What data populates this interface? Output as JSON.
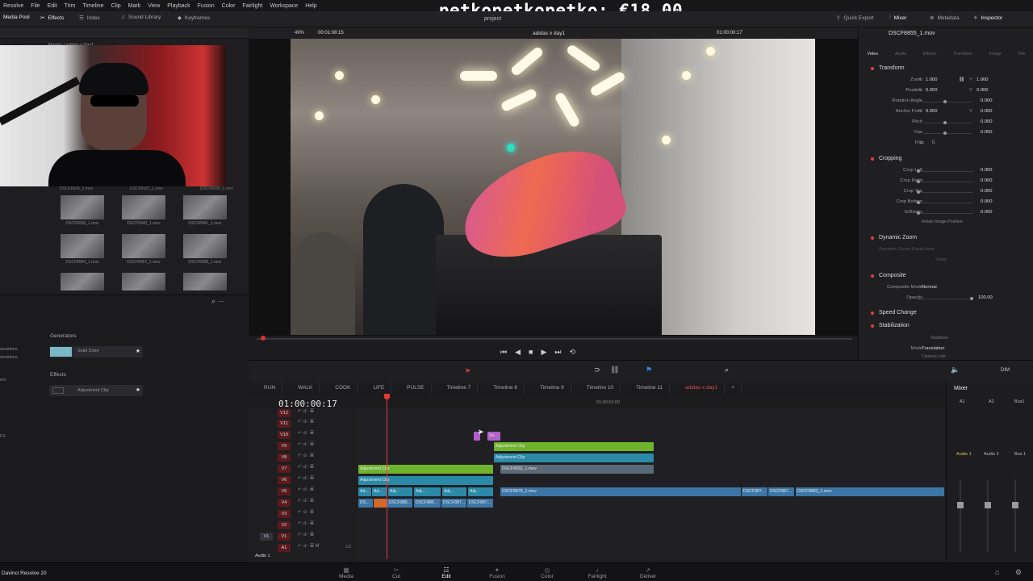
{
  "menubar": {
    "items": [
      "Resolve",
      "File",
      "Edit",
      "Trim",
      "Timeline",
      "Clip",
      "Mark",
      "View",
      "Playback",
      "Fusion",
      "Color",
      "Fairlight",
      "Workspace",
      "Help"
    ]
  },
  "overlay": {
    "donation_text": "petkopetkopetko: €18.00"
  },
  "toolbar": {
    "media_pool": "Media Pool",
    "effects": "Effects",
    "index": "Index",
    "sound_library": "Sound Library",
    "keyframes": "Keyframes",
    "project": "project",
    "quick_export": "Quick Export",
    "mixer": "Mixer",
    "metadata": "Metadata",
    "inspector": "Inspector"
  },
  "media_pool": {
    "breadcrumb": "Master / adidas x Day1",
    "thumbs": [
      "DSCF8939_1.mov",
      "DSCF8940_1.mov",
      "DSCF8941_1.mov",
      "DSCF8954_1.mov",
      "DSCF8967_1.mov",
      "DSCF8968_1.mov"
    ],
    "top_row": [
      "DSCF8936_1.mov",
      "DSCF8937_1.mov",
      "DSCF8938_1.mov"
    ]
  },
  "effects_panel": {
    "side_labels": [
      "ansitions",
      "ansitions",
      "ors",
      "FX"
    ],
    "generators_title": "Generators",
    "generator_item": "Solid Color",
    "effects_title": "Effects",
    "effect_item": "Adjustment Clip",
    "star": "★"
  },
  "viewer": {
    "zoom": "49%",
    "source_tc": "00:01:08:15",
    "timeline_name": "adidas x day1",
    "record_tc": "01:00:00:17",
    "transport": [
      "⏮",
      "◀",
      "■",
      "▶",
      "⏭",
      "⟲"
    ]
  },
  "inspector": {
    "clip_name": "DSCF8855_1.mov",
    "tabs": [
      "Video",
      "Audio",
      "Effects",
      "Transition",
      "Image",
      "File"
    ],
    "transform": "Transform",
    "zoom_label": "Zoom",
    "zoom_x": "1.000",
    "zoom_y": "1.000",
    "position_label": "Position",
    "position_x": "0.000",
    "position_y": "0.000",
    "rotation_label": "Rotation Angle",
    "rotation_value": "0.000",
    "anchor_label": "Anchor Point",
    "anchor_x": "0.000",
    "anchor_y": "0.000",
    "pitch_label": "Pitch",
    "pitch_value": "0.000",
    "yaw_label": "Yaw",
    "yaw_value": "0.000",
    "flip_label": "Flip",
    "cropping": "Cropping",
    "crop_left_label": "Crop Left",
    "crop_left": "0.000",
    "crop_right_label": "Crop Right",
    "crop_right": "0.000",
    "crop_top_label": "Crop Top",
    "crop_top": "0.000",
    "crop_bottom_label": "Crop Bottom",
    "crop_bottom": "0.000",
    "softness_label": "Softness",
    "softness": "0.000",
    "retain_label": "Retain Image Position",
    "dynamic_zoom": "Dynamic Zoom",
    "dz_ease_label": "Dynamic Zoom Ease",
    "dz_ease": "Linear",
    "swap": "Swap",
    "composite": "Composite",
    "composite_mode_label": "Composite Mode",
    "composite_mode": "Normal",
    "opacity_label": "Opacity",
    "opacity": "100.00",
    "speed_change": "Speed Change",
    "stabilization": "Stabilization",
    "stabilize": "Stabilize",
    "mode_label": "Mode",
    "mode_value": "Translation",
    "camera_lock": "Camera Lock",
    "axis_x": "X",
    "axis_y": "Y"
  },
  "timeline": {
    "timecode": "01:00:00:17",
    "ruler_mark": "01:00:02:00",
    "tabs": [
      "RUN",
      "WALK",
      "COOK",
      "LIFE",
      "PULSE",
      "Timeline 7",
      "Timeline 8",
      "Timeline 9",
      "Timeline 10",
      "Timeline 11",
      "adidas x day1"
    ],
    "active_tab_index": 10,
    "tracks": [
      "V12",
      "V11",
      "V10",
      "V9",
      "V8",
      "V7",
      "V6",
      "V5",
      "V4",
      "V3",
      "V2",
      "V1",
      "A1"
    ],
    "audio_label": "Audio 1",
    "audio_level": "2.0",
    "clips": {
      "v10_small": "So...",
      "v9_adj": "Adjustment Clip",
      "v8_adj": "Adjustment Clip",
      "v8_mov": "DSCF8932_1.mov",
      "v7_adj": "Adjustment Clip",
      "v6_adj": "Adjustment Clip",
      "v5_a1": "Ad...",
      "v5_a2": "Ad...",
      "v5_a3": "Adj...",
      "v5_a4": "Adj...",
      "v5_a5": "Adj...",
      "v5_a6": "Adj...",
      "v5_main": "DSCF8876_1.mov",
      "v5_b": "DSCF887...",
      "v5_c": "DSCF887...",
      "v5_d": "DSCF8882_1.mov",
      "v4_a": "DS...",
      "v4_b": "DSCF885...",
      "v4_c": "DSCF885...",
      "v4_d": "DSCF887...",
      "v4_e": "DSCF887..."
    }
  },
  "mixer": {
    "title": "Mixer",
    "cols": [
      "A1",
      "A2",
      "Bus1"
    ],
    "names": [
      "Audio 1",
      "Audio 2",
      "Bus 1"
    ],
    "dim": "DIM"
  },
  "pages": {
    "items": [
      "Media",
      "Cut",
      "Edit",
      "Fusion",
      "Color",
      "Fairlight",
      "Deliver"
    ],
    "selected": "Edit"
  },
  "app": {
    "name": "Davinci Resolve 20"
  }
}
